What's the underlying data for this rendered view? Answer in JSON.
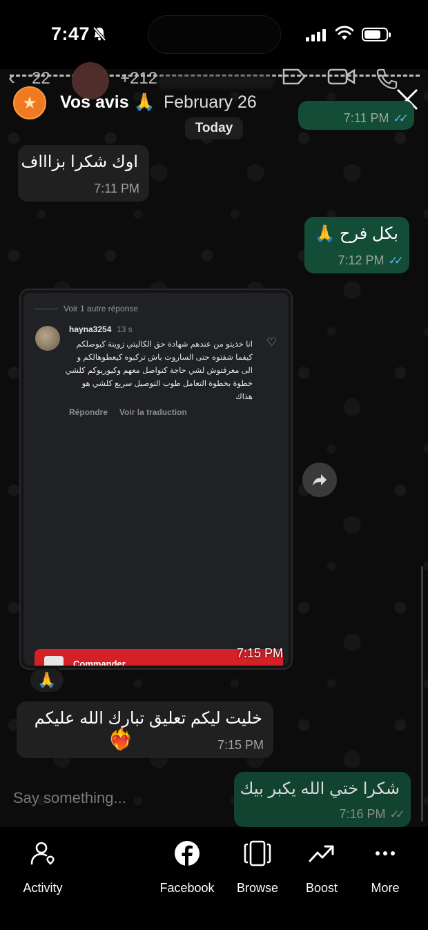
{
  "status_bar": {
    "time": "7:47"
  },
  "background_chat": {
    "unread_count": "22",
    "contact_name": "+212"
  },
  "story": {
    "title": "Vos avis 🙏",
    "date": "February 26"
  },
  "chat": {
    "date_separator": "Today",
    "messages": [
      {
        "direction": "outgoing",
        "text": "",
        "time": "7:11 PM",
        "status": "read"
      },
      {
        "direction": "incoming",
        "text": "اوك شكرا بزاااف",
        "time": "7:11 PM"
      },
      {
        "direction": "outgoing",
        "text": "بكل فرح 🙏",
        "time": "7:12 PM",
        "status": "read"
      },
      {
        "direction": "incoming",
        "type": "image",
        "time": "7:15 PM",
        "reaction": "🙏"
      },
      {
        "direction": "incoming",
        "text": "خليت ليكم تعليق تبارك الله عليكم",
        "emoji": "❤️‍🔥",
        "time": "7:15 PM"
      },
      {
        "direction": "outgoing",
        "text": "شكرا ختي الله يكبر بيك",
        "time": "7:16 PM",
        "status": "delivered"
      }
    ]
  },
  "attachment": {
    "more_replies": "Voir 1 autre réponse",
    "username": "hayna3254",
    "age": "13 s",
    "comment": "انا خذيتو من عندهم شهادة حق الكاليتي زوينة كيوصلكم كيفما شفتوه حتى الساروت باش تركبوه كيعطوهالكم و الى معرفتوش لشي حاجة كتواصل معهم وكيوريوكم كلشي خطوة بخطوة التعامل طوب التوصيل سريع كلشي هو هذاك",
    "reply": "Répondre",
    "translate": "Voir la traduction",
    "cta": "Commander"
  },
  "reply_input": {
    "placeholder": "Say something..."
  },
  "bottom_nav": [
    {
      "label": "Activity",
      "icon": "activity-icon"
    },
    {
      "label": "Facebook",
      "icon": "facebook-icon"
    },
    {
      "label": "Browse",
      "icon": "browse-icon"
    },
    {
      "label": "Boost",
      "icon": "boost-icon"
    },
    {
      "label": "More",
      "icon": "more-icon"
    }
  ]
}
